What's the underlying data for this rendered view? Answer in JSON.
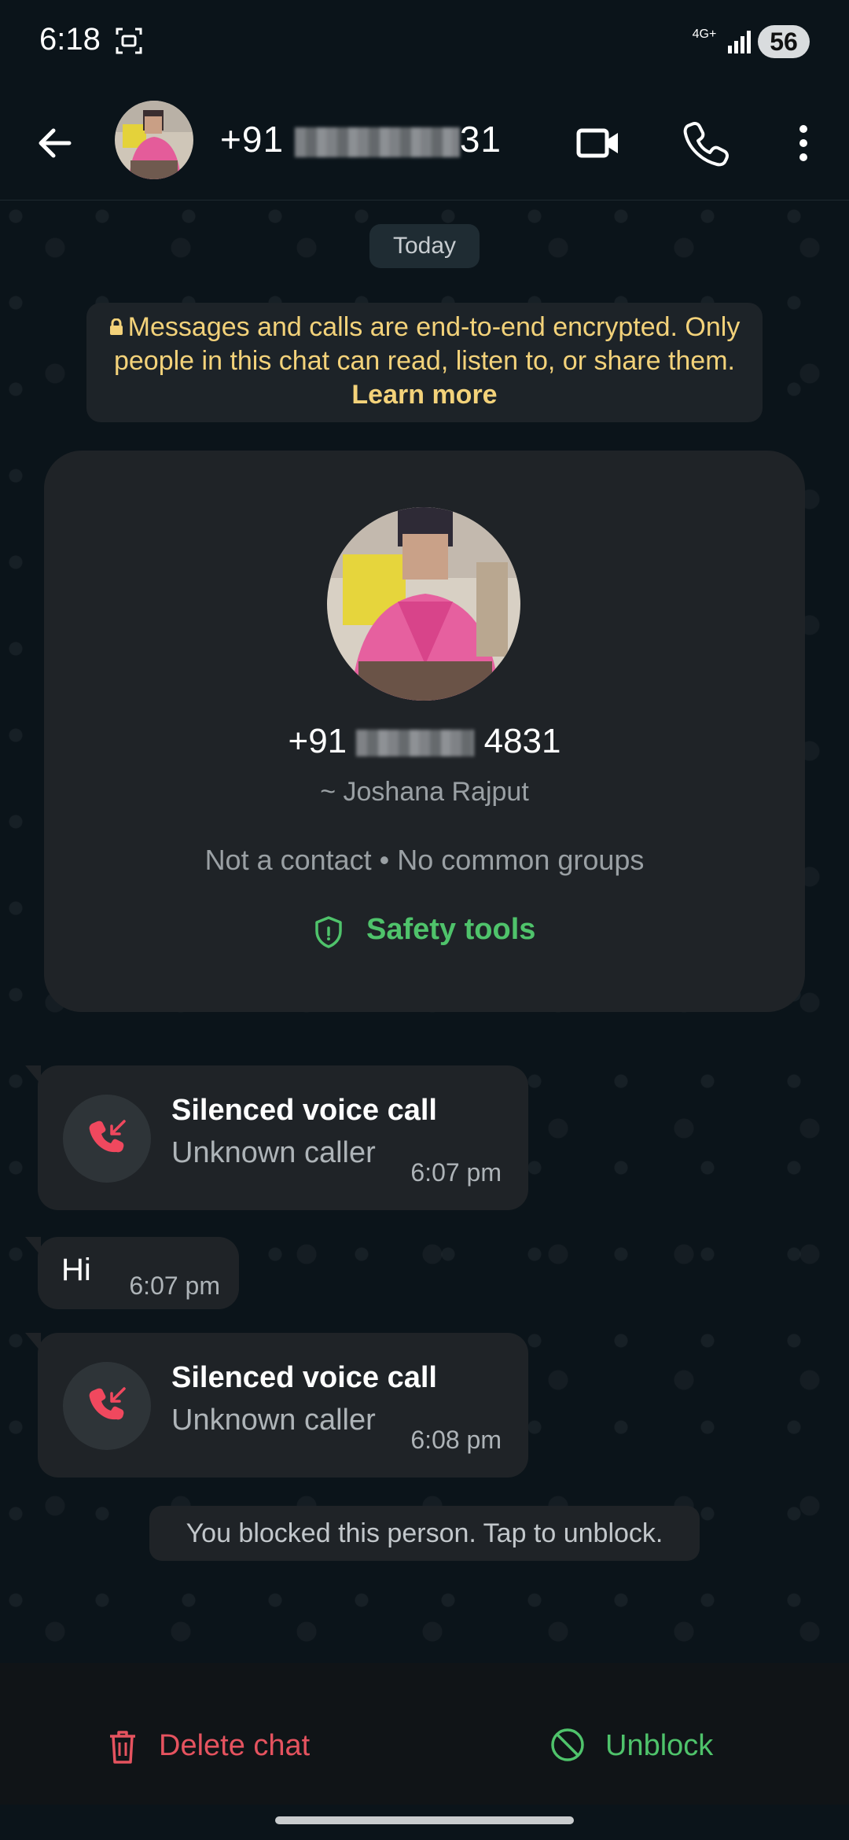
{
  "status_bar": {
    "time": "6:18",
    "network": "4G+",
    "battery": "56"
  },
  "header": {
    "title_prefix": "+91",
    "title_suffix": "31"
  },
  "chat": {
    "date_chip": "Today",
    "encryption_notice": {
      "text": "Messages and calls are end-to-end encrypted. Only people in this chat can read, listen to, or share them.",
      "link": "Learn more"
    },
    "profile_card": {
      "number_prefix": "+91",
      "number_suffix": "4831",
      "name": "~ Joshana Rajput",
      "meta": "Not a contact • No common groups",
      "safety_tools": "Safety tools"
    },
    "messages": [
      {
        "type": "call",
        "title": "Silenced voice call",
        "subtitle": "Unknown caller",
        "time": "6:07 pm"
      },
      {
        "type": "text",
        "text": "Hi",
        "time": "6:07 pm"
      },
      {
        "type": "call",
        "title": "Silenced voice call",
        "subtitle": "Unknown caller",
        "time": "6:08 pm"
      }
    ],
    "blocked_notice": "You blocked this person. Tap to unblock."
  },
  "bottom_bar": {
    "delete_label": "Delete chat",
    "unblock_label": "Unblock"
  },
  "colors": {
    "accent_green": "#4fc36b",
    "danger_red": "#e5535f",
    "notice_yellow": "#f3d27a",
    "background": "#0b141a"
  },
  "icons": [
    "screenshot-icon",
    "signal-icon",
    "back-arrow-icon",
    "video-call-icon",
    "voice-call-icon",
    "more-vert-icon",
    "lock-icon",
    "shield-icon",
    "missed-call-icon",
    "trash-icon",
    "block-icon"
  ]
}
